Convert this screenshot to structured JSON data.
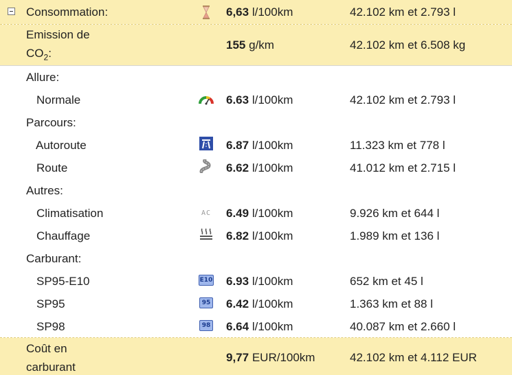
{
  "summary": {
    "consumption": {
      "label": "Consommation:",
      "value": "6,63",
      "unit": "l/100km",
      "total": "42.102 km et 2.793 l"
    },
    "emission": {
      "label_line1": "Emission de",
      "label_line2_prefix": "CO",
      "label_line2_sub": "2",
      "label_line2_suffix": ":",
      "value": "155",
      "unit": "g/km",
      "total": "42.102 km et 6.508 kg"
    }
  },
  "groups": [
    {
      "title": "Allure:",
      "items": [
        {
          "label": "Normale",
          "icon": "speedometer-icon",
          "value": "6.63",
          "unit": "l/100km",
          "total": "42.102 km et 2.793 l"
        }
      ]
    },
    {
      "title": "Parcours:",
      "items": [
        {
          "label": "Autoroute",
          "icon": "highway-icon",
          "value": "6.87",
          "unit": "l/100km",
          "total": "11.323 km et 778 l"
        },
        {
          "label": "Route",
          "icon": "winding-road-icon",
          "value": "6.62",
          "unit": "l/100km",
          "total": "41.012 km et 2.715 l"
        }
      ]
    },
    {
      "title": "Autres:",
      "items": [
        {
          "label": "Climatisation",
          "icon": "air-conditioning-icon",
          "icon_text": "AC",
          "value": "6.49",
          "unit": "l/100km",
          "total": "9.926 km et 644 l"
        },
        {
          "label": "Chauffage",
          "icon": "heating-icon",
          "value": "6.82",
          "unit": "l/100km",
          "total": "1.989 km et 136 l"
        }
      ]
    },
    {
      "title": "Carburant:",
      "items": [
        {
          "label": "SP95-E10",
          "icon": "fuel-e10-icon",
          "icon_text": "E10",
          "value": "6.93",
          "unit": "l/100km",
          "total": "652 km et 45 l"
        },
        {
          "label": "SP95",
          "icon": "fuel-95-icon",
          "icon_text": "95",
          "value": "6.42",
          "unit": "l/100km",
          "total": "1.363 km et 88 l"
        },
        {
          "label": "SP98",
          "icon": "fuel-98-icon",
          "icon_text": "98",
          "value": "6.64",
          "unit": "l/100km",
          "total": "40.087 km et 2.660 l"
        }
      ]
    }
  ],
  "cost": {
    "label_line1": "Coût en",
    "label_line2": "carburant",
    "value": "9,77",
    "unit": "EUR/100km",
    "total": "42.102 km et 4.112 EUR"
  },
  "colors": {
    "highlight": "#fbeeb3",
    "fuel_badge": "#9fb7ec",
    "highway_sign": "#2f4ea8"
  }
}
